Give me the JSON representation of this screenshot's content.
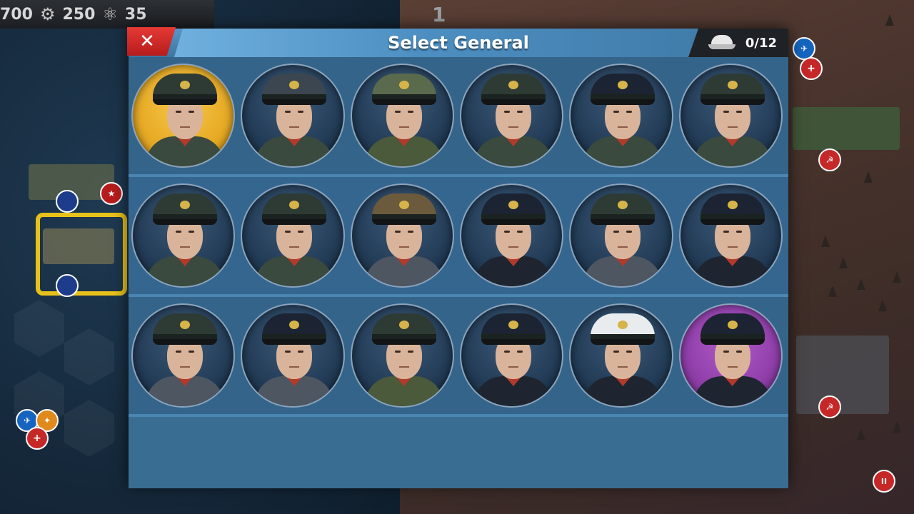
{
  "resources": [
    {
      "icon": "gear-icon",
      "value": "250"
    },
    {
      "icon": "atom-icon",
      "value": "35"
    }
  ],
  "resource_partial": "700",
  "map_top_number": "1",
  "modal": {
    "title": "Select General",
    "counter": "0/12",
    "close_symbol": "✕"
  },
  "generals": [
    [
      {
        "bg": "gold",
        "cap": "",
        "uniform": ""
      },
      {
        "bg": "",
        "cap": "grey",
        "uniform": ""
      },
      {
        "bg": "",
        "cap": "camo",
        "uniform": "green"
      },
      {
        "bg": "",
        "cap": "",
        "uniform": ""
      },
      {
        "bg": "",
        "cap": "navy",
        "uniform": ""
      },
      {
        "bg": "",
        "cap": "",
        "uniform": ""
      }
    ],
    [
      {
        "bg": "",
        "cap": "",
        "uniform": ""
      },
      {
        "bg": "",
        "cap": "",
        "uniform": ""
      },
      {
        "bg": "",
        "cap": "tan",
        "uniform": "grey"
      },
      {
        "bg": "",
        "cap": "navy",
        "uniform": "dark"
      },
      {
        "bg": "",
        "cap": "",
        "uniform": "grey"
      },
      {
        "bg": "",
        "cap": "navy",
        "uniform": "dark"
      }
    ],
    [
      {
        "bg": "",
        "cap": "",
        "uniform": "grey"
      },
      {
        "bg": "",
        "cap": "navy",
        "uniform": "grey"
      },
      {
        "bg": "",
        "cap": "",
        "uniform": "green"
      },
      {
        "bg": "",
        "cap": "navy",
        "uniform": "dark"
      },
      {
        "bg": "",
        "cap": "white",
        "uniform": "dark"
      },
      {
        "bg": "purple",
        "cap": "navy",
        "uniform": "dark"
      }
    ]
  ]
}
